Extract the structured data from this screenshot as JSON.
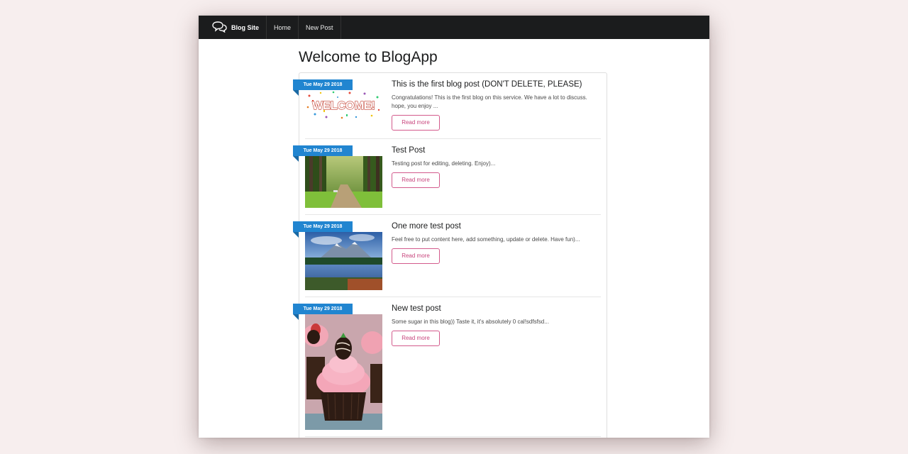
{
  "navbar": {
    "brand": "Blog Site",
    "brand_icon": "chat-bubbles-icon",
    "links": [
      "Home",
      "New Post"
    ]
  },
  "page": {
    "title": "Welcome to BlogApp"
  },
  "posts": [
    {
      "date": "Tue May 29 2018",
      "title": "This is the first blog post (DON'T DELETE, PLEASE)",
      "excerpt": "Congratulations! This is the first blog on this service. We have a lot to discuss. hope, you enjoy ...",
      "image_text": "WELCOME!",
      "button": "Read more"
    },
    {
      "date": "Tue May 29 2018",
      "title": "Test Post",
      "excerpt": "Testing post for editing, deleting. Enjoy)...",
      "button": "Read more"
    },
    {
      "date": "Tue May 29 2018",
      "title": "One more test post",
      "excerpt": "Feel free to put content here, add something, update or delete. Have fun)...",
      "button": "Read more"
    },
    {
      "date": "Tue May 29 2018",
      "title": "New test post",
      "excerpt": "Some sugar in this blog)) Taste it, it's absolutely 0 cal!sdfsfsd...",
      "button": "Read more"
    }
  ],
  "colors": {
    "navbar": "#1b1c1d",
    "ribbon": "#2185d0",
    "button_border": "#d35a8c",
    "background": "#f7eeee"
  }
}
